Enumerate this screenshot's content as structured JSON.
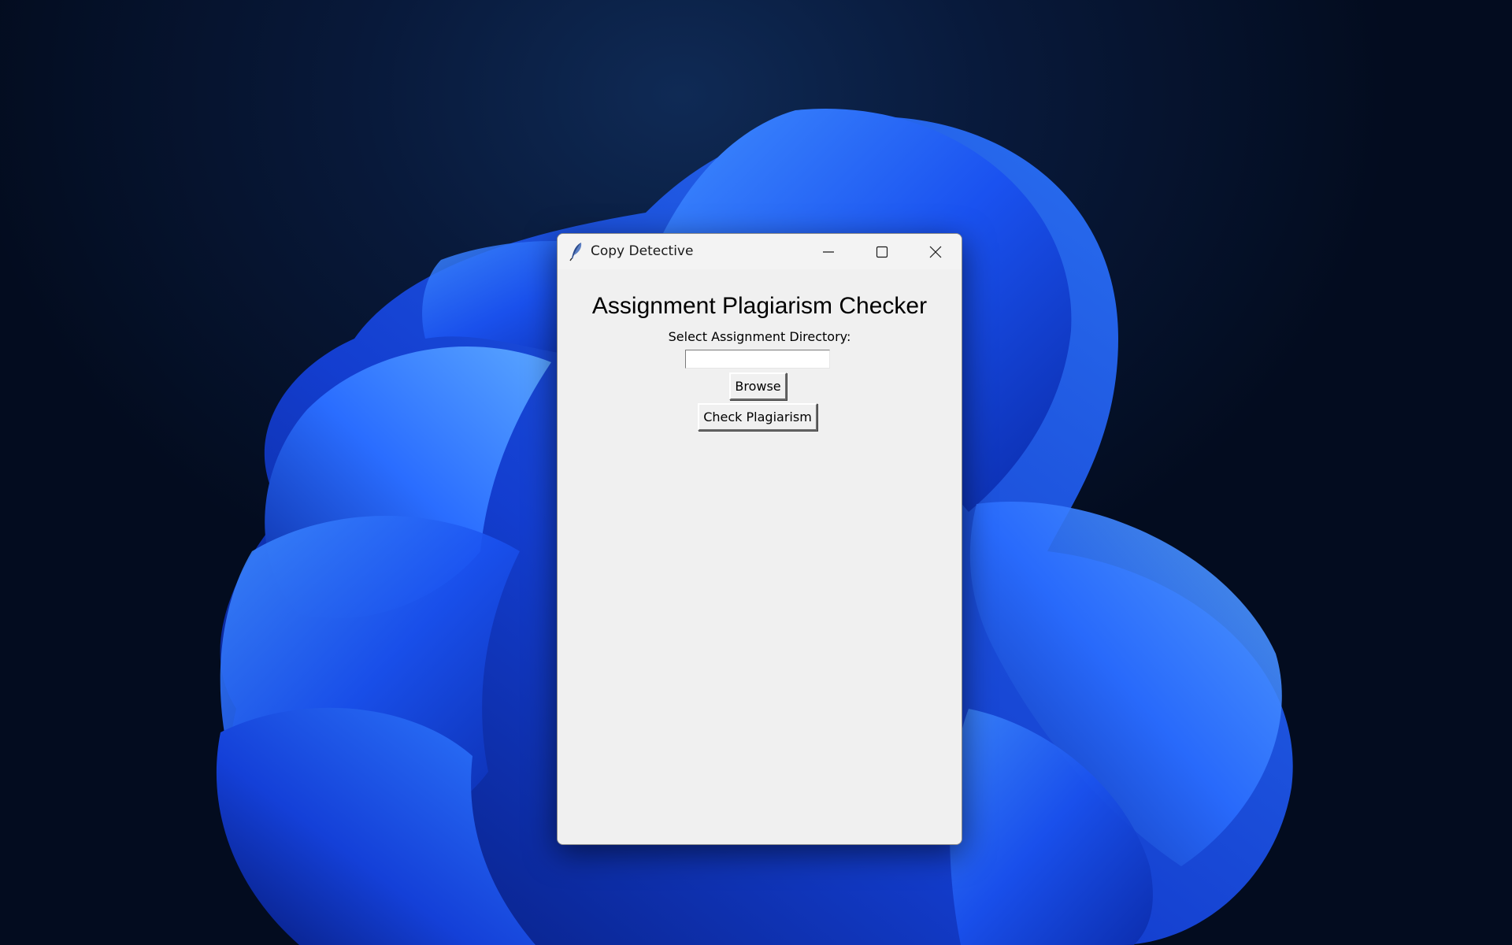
{
  "window": {
    "title": "Copy Detective",
    "app_icon": "feather-icon"
  },
  "caption_buttons": {
    "minimize_icon": "minimize-icon",
    "maximize_icon": "maximize-icon",
    "close_icon": "close-icon"
  },
  "main": {
    "heading": "Assignment Plagiarism Checker",
    "directory_label": "Select Assignment Directory:",
    "directory_value": "",
    "browse_label": "Browse",
    "check_label": "Check Plagiarism"
  },
  "colors": {
    "window_bg": "#f0f0f0",
    "wallpaper_bg": "#08193a",
    "wallpaper_accent": "#1f5cff"
  }
}
